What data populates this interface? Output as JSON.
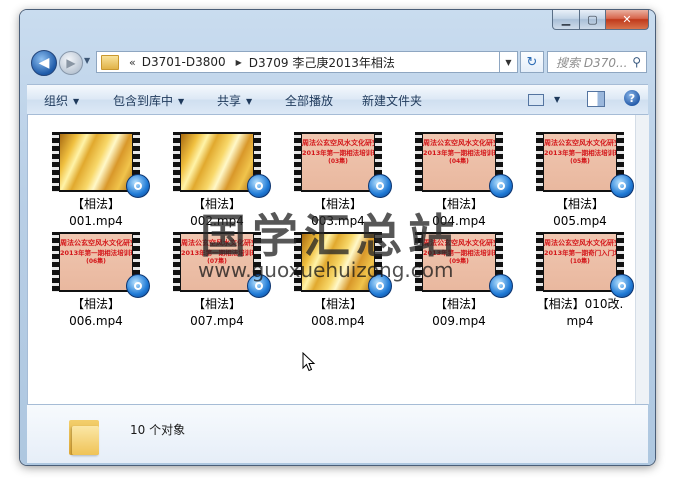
{
  "window": {
    "caption_buttons": {
      "minimize_icon": "minimize-icon",
      "maximize_icon": "maximize-icon",
      "close_icon": "close-icon"
    }
  },
  "nav": {
    "back_icon": "back-arrow-icon",
    "forward_icon": "forward-arrow-icon",
    "breadcrumb_overflow": "«",
    "breadcrumb": [
      "D3701-D3800",
      "D3709 李己庚2013年相法"
    ],
    "search_placeholder": "搜索 D370...",
    "refresh_icon": "refresh-icon",
    "search_icon": "search-icon"
  },
  "toolbar": {
    "organize": "组织",
    "include_in_library": "包含到库中",
    "share": "共享",
    "play_all": "全部播放",
    "new_folder": "新建文件夹",
    "view_icon": "view-options-icon",
    "preview_pane_icon": "preview-pane-icon",
    "help_icon": "help-icon"
  },
  "files": [
    {
      "name_line1": "【相法】",
      "name_line2": "001.mp4",
      "thumb": "gold"
    },
    {
      "name_line1": "【相法】",
      "name_line2": "002.mp4",
      "thumb": "gold"
    },
    {
      "name_line1": "【相法】",
      "name_line2": "003.mp4",
      "thumb": "red",
      "title_lines": [
        "周法公玄空风水文化研究学",
        "2013年第一期相法培训班",
        "(03集)"
      ]
    },
    {
      "name_line1": "【相法】",
      "name_line2": "004.mp4",
      "thumb": "red",
      "title_lines": [
        "周法公玄空风水文化研究学",
        "2013年第一期相法培训班",
        "(04集)"
      ]
    },
    {
      "name_line1": "【相法】",
      "name_line2": "005.mp4",
      "thumb": "red",
      "title_lines": [
        "周法公玄空风水文化研究学",
        "2013年第一期相法培训班",
        "(05集)"
      ]
    },
    {
      "name_line1": "【相法】",
      "name_line2": "006.mp4",
      "thumb": "red",
      "title_lines": [
        "周法公玄空风水文化研究学",
        "2013年第一期相法培训班",
        "(06集)"
      ]
    },
    {
      "name_line1": "【相法】",
      "name_line2": "007.mp4",
      "thumb": "red",
      "title_lines": [
        "周法公玄空风水文化研究学",
        "2013年第一期相法培训班",
        "(07集)"
      ]
    },
    {
      "name_line1": "【相法】",
      "name_line2": "008.mp4",
      "thumb": "gold"
    },
    {
      "name_line1": "【相法】",
      "name_line2": "009.mp4",
      "thumb": "red",
      "title_lines": [
        "周法公玄空风水文化研究学",
        "2013年第一期相法培训班",
        "(09集)"
      ]
    },
    {
      "name_line1": "【相法】010改.",
      "name_line2": "mp4",
      "thumb": "red",
      "title_lines": [
        "周法公玄空风水文化研究学",
        "2013年第一期奇门入门培训",
        "(10集)"
      ]
    }
  ],
  "watermark": {
    "text_cn": "国学汇总站",
    "url": "www.guoxuehuizong.com"
  },
  "details": {
    "count": "10 个对象",
    "folder_icon": "folder-icon"
  },
  "colors": {
    "accent": "#1e5aa8",
    "title_red": "#d3161a",
    "toolbar_text": "#1e395b"
  }
}
